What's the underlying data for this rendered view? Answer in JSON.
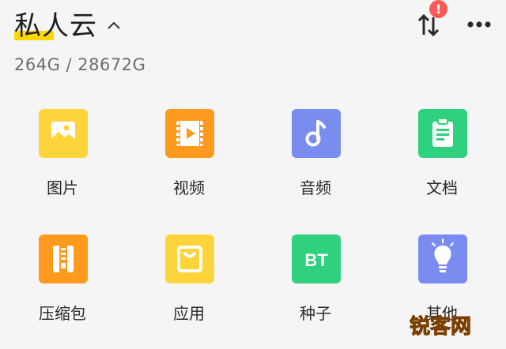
{
  "header": {
    "title": "私人云",
    "storage": "264G / 28672G",
    "badge_count": "!"
  },
  "tiles": [
    {
      "label": "图片",
      "color": "#ffd43b",
      "icon": "image-icon"
    },
    {
      "label": "视频",
      "color": "#ff9a1f",
      "icon": "video-icon"
    },
    {
      "label": "音频",
      "color": "#7b8cf0",
      "icon": "music-note-icon"
    },
    {
      "label": "文档",
      "color": "#2fd07e",
      "icon": "document-icon"
    },
    {
      "label": "压缩包",
      "color": "#ff9a1f",
      "icon": "zip-icon"
    },
    {
      "label": "应用",
      "color": "#ffd43b",
      "icon": "app-bag-icon"
    },
    {
      "label": "种子",
      "color": "#2fd07e",
      "icon": "bt-icon",
      "icon_text": "BT"
    },
    {
      "label": "其他",
      "color": "#7b8cf0",
      "icon": "bulb-icon"
    }
  ],
  "watermark": "锐客网",
  "colors": {
    "background": "#f5f5f5",
    "highlight": "#ffd600",
    "badge": "#ff5a5a"
  }
}
